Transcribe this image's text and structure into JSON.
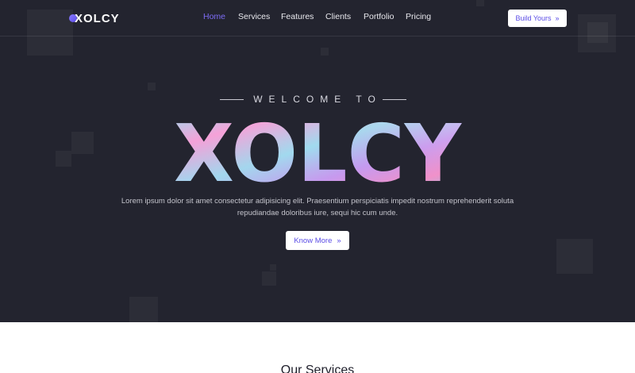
{
  "brand": {
    "logo_text": "XOLCY"
  },
  "nav": {
    "items": [
      {
        "label": "Home",
        "active": true
      },
      {
        "label": "Services",
        "active": false
      },
      {
        "label": "Features",
        "active": false
      },
      {
        "label": "Clients",
        "active": false
      },
      {
        "label": "Portfolio",
        "active": false
      },
      {
        "label": "Pricing",
        "active": false
      }
    ],
    "cta_label": "Build Yours",
    "cta_icon": "double-chevron-right-icon"
  },
  "hero": {
    "eyebrow": "WELCOME TO",
    "title": "XOLCY",
    "description_line1": "Lorem ipsum dolor sit amet consectetur adipisicing elit. Praesentium perspiciatis impedit nostrum reprehenderit soluta",
    "description_line2": "repudiandae doloribus iure, sequi hic cum unde.",
    "button_label": "Know More",
    "button_icon": "double-chevron-right-icon"
  },
  "services": {
    "heading": "Our Services"
  },
  "colors": {
    "hero_bg": "#23242f",
    "accent": "#7d6cf6",
    "button_text": "#5b4de6",
    "title_gradient": [
      "#7ee0f0",
      "#f39bd6",
      "#b68df0",
      "#5fd0e8"
    ]
  }
}
